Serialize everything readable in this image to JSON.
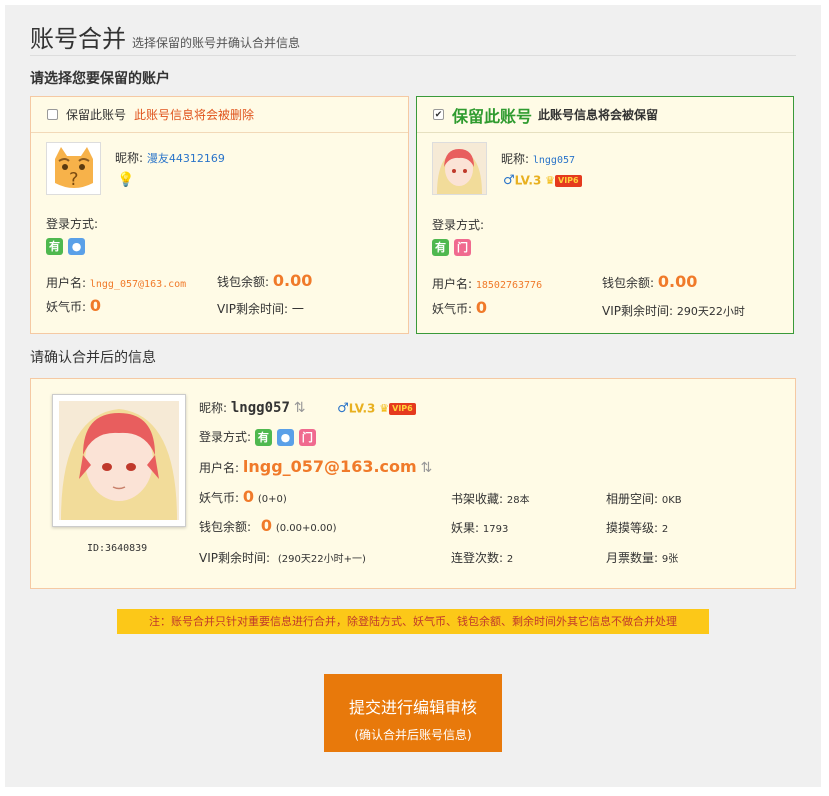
{
  "header": {
    "title": "账号合并",
    "subtitle": "选择保留的账号并确认合并信息"
  },
  "select_prompt": "请选择您要保留的账户",
  "left_account": {
    "checkbox_label": "保留此账号",
    "warning": "此账号信息将会被删除",
    "nickname_label": "昵称:",
    "nickname": "漫友44312169",
    "login_label": "登录方式:",
    "login_icons": [
      "有",
      "QQ"
    ],
    "username_label": "用户名:",
    "username": "lngg_057@163.com",
    "wallet_label": "钱包余额:",
    "wallet": "0.00",
    "coins_label": "妖气币:",
    "coins": "0",
    "vip_label": "VIP剩余时间:",
    "vip": "一"
  },
  "right_account": {
    "keep_label": "保留此账号",
    "keep_note": "此账号信息将会被保留",
    "nickname_label": "昵称:",
    "nickname": "lngg057",
    "level": "LV.3",
    "vip_badge": "VIP6",
    "login_label": "登录方式:",
    "login_icons": [
      "有",
      "门"
    ],
    "username_label": "用户名:",
    "username": "18502763776",
    "wallet_label": "钱包余额:",
    "wallet": "0.00",
    "coins_label": "妖气币:",
    "coins": "0",
    "vip_label": "VIP剩余时间:",
    "vip": "290天22小时"
  },
  "confirm_prompt": "请确认合并后的信息",
  "merged": {
    "id": "ID:3640839",
    "nickname_label": "昵称:",
    "nickname": "lngg057",
    "level": "LV.3",
    "vip_badge": "VIP6",
    "login_label": "登录方式:",
    "login_icons": [
      "有",
      "QQ",
      "门"
    ],
    "username_label": "用户名:",
    "username": "lngg_057@163.com",
    "coins_label": "妖气币:",
    "coins": "0",
    "coins_detail": "(0+0)",
    "wallet_label": "钱包余额:",
    "wallet": "0",
    "wallet_detail": "(0.00+0.00)",
    "vip_label": "VIP剩余时间:",
    "vip_detail": "(290天22小时+一)",
    "shelf_label": "书架收藏:",
    "shelf": "28本",
    "yaoguo_label": "妖果:",
    "yaoguo": "1793",
    "login_days_label": "连登次数:",
    "login_days": "2",
    "album_label": "相册空间:",
    "album": "0KB",
    "touch_label": "摸摸等级:",
    "touch": "2",
    "ticket_label": "月票数量:",
    "ticket": "9张"
  },
  "notice": "注：账号合并只针对重要信息进行合并，除登陆方式、妖气币、钱包余额、剩余时间外其它信息不做合并处理",
  "submit": {
    "main": "提交进行编辑审核",
    "sub": "(确认合并后账号信息)"
  },
  "colors": {
    "accent": "#e8790b",
    "warning": "#e0531c",
    "keep": "#2f9b2f",
    "card_bg": "#fffbe6"
  }
}
